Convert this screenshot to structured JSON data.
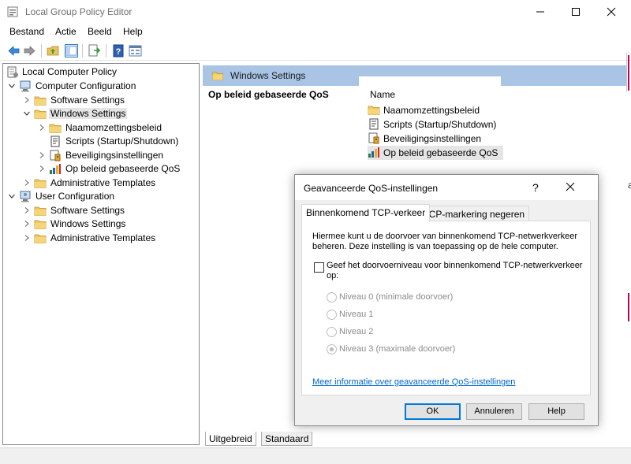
{
  "window": {
    "title": "Local Group Policy Editor"
  },
  "menu": [
    "Bestand",
    "Actie",
    "Beeld",
    "Help"
  ],
  "tree": {
    "root": "Local Computer Policy",
    "computer_config": "Computer Configuration",
    "cc_software": "Software Settings",
    "cc_windows": "Windows Settings",
    "cc_naam": "Naamomzettingsbeleid",
    "cc_scripts": "Scripts (Startup/Shutdown)",
    "cc_beveiliging": "Beveiligingsinstellingen",
    "cc_qos": "Op beleid gebaseerde QoS",
    "cc_admin": "Administrative Templates",
    "user_config": "User Configuration",
    "uc_software": "Software Settings",
    "uc_windows": "Windows Settings",
    "uc_admin": "Administrative Templates"
  },
  "right": {
    "header": "Windows Settings",
    "section": "Op beleid gebaseerde QoS",
    "column": "Name",
    "items": [
      "Naamomzettingsbeleid",
      "Scripts (Startup/Shutdown)",
      "Beveiligingsinstellingen",
      "Op beleid gebaseerde QoS"
    ],
    "tabs": [
      "Uitgebreid",
      "Standaard"
    ]
  },
  "dialog": {
    "title": "Geavanceerde QoS-instellingen",
    "help_glyph": "?",
    "tabs": [
      "Binnenkomend TCP-verkeer",
      "DSCP-markering negeren"
    ],
    "description": "Hiermee kunt u de doorvoer van binnenkomend TCP-netwerkverkeer beheren. Deze instelling is van toepassing op de hele computer.",
    "checkbox_label": "Geef het doorvoerniveau voor binnenkomend TCP-netwerkverkeer op:",
    "checkbox_checked": false,
    "radios": [
      "Niveau 0 (minimale doorvoer)",
      "Niveau 1",
      "Niveau 2",
      "Niveau 3 (maximale doorvoer)"
    ],
    "selected_radio": "Niveau 3 (maximale doorvoer)",
    "link": "Meer informatie over geavanceerde QoS-instellingen",
    "buttons": {
      "ok": "OK",
      "cancel": "Annuleren",
      "help": "Help"
    }
  },
  "edge_char": "a",
  "colors": {
    "header_bg": "#a9c4e4",
    "selection": "#e5e5e5",
    "link": "#0066cc",
    "accent": "#0078d7"
  }
}
